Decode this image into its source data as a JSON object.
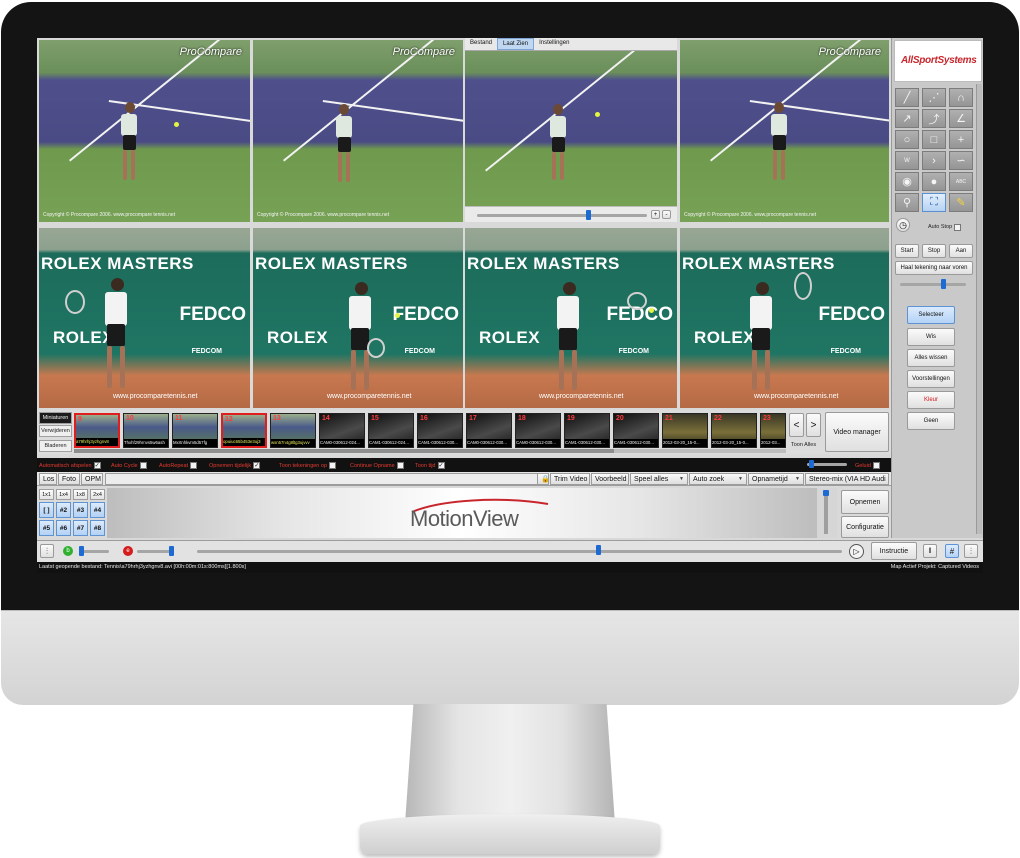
{
  "overlay": {
    "procompare_logo": "ProCompare",
    "copyright": "Copyright © Procompare 2006.  www.procompare tennis.net",
    "wall_words": [
      "ROLEX MASTERS",
      "ROLEX",
      "FEDCO",
      "FEDCOM",
      "www.procomparetennis.net"
    ]
  },
  "tile3_tabs": [
    "Bestand",
    "Laat Zien",
    "Instellingen"
  ],
  "right_panel": {
    "brand": "AllSportSystems",
    "autostop_label": "Auto Stop",
    "start": "Start",
    "stop": "Stop",
    "aan": "Aan",
    "haal_label": "Haal tekening naar voren",
    "buttons": [
      "Selecteer",
      "Wis",
      "Alles wissen",
      "Voorstellingen",
      "Kleur",
      "Geen"
    ]
  },
  "strip": {
    "tabs": [
      "Miniaturen",
      "Verwijderen",
      "Bladeren"
    ],
    "thumbs": [
      {
        "num": "9",
        "cap": "a79hrhj3yzhgnv8"
      },
      {
        "num": "10",
        "cap": "Thxhf29hrnvs5w6ash"
      },
      {
        "num": "11",
        "cap": "Mxrtnhkvm5d57fg"
      },
      {
        "num": "12",
        "cap": "opuiuc65b453e3uj3"
      },
      {
        "num": "13",
        "cap": "wsn57n4g8ltg3ujvvv"
      },
      {
        "num": "14",
        "cap": "CAM0-030612-024..."
      },
      {
        "num": "15",
        "cap": "CAM1-030612-024..."
      },
      {
        "num": "16",
        "cap": "CAM1-030612-030..."
      },
      {
        "num": "17",
        "cap": "CAM0-030612-030..."
      },
      {
        "num": "18",
        "cap": "CAM0-030612-030..."
      },
      {
        "num": "19",
        "cap": "CAM1-030612-030..."
      },
      {
        "num": "20",
        "cap": "CAM1-030612-030..."
      },
      {
        "num": "21",
        "cap": "2012-03-20_15-0..."
      },
      {
        "num": "22",
        "cap": "2012-03-20_15-0..."
      },
      {
        "num": "23",
        "cap": "2012-03..."
      }
    ],
    "prev": "<",
    "next": ">",
    "toon_alles": "Toon Alles",
    "video_manager": "Video manager"
  },
  "checkboxes": [
    "Automatisch afspelen",
    "Auto Cycle",
    "AutoRepeat",
    "Opnemen tijdelijk",
    "Toon tekeningen op",
    "Continue Opname",
    "Toon tijd",
    "Geluid"
  ],
  "menu": {
    "los": "Los",
    "foto": "Foto",
    "opm": "OPM",
    "trim_video": "Trim Video",
    "voorbeeld": "Voorbeeld",
    "speel_alles": "Speel alles",
    "auto_zoek": "Auto zoek",
    "opnametijd": "Opnametijd",
    "stereo": "Stereo-mix (VIA HD Audi"
  },
  "layout_buttons": {
    "row1": [
      "1x1",
      "1x4",
      "1x8",
      "2x4"
    ],
    "row2": [
      "[ ]",
      "#2",
      "#3",
      "#4"
    ],
    "row3": [
      "#5",
      "#6",
      "#7",
      "#8"
    ]
  },
  "logo": {
    "motion": "Motion",
    "view": "View"
  },
  "actions": {
    "opnemen": "Opnemen",
    "configuratie": "Configuratie",
    "instructie": "Instructie"
  },
  "status": {
    "left": "Laatst geopende bestand: Tennis\\a79hrhj3yzhgnv8.avi   [00h:00m:01s:800ms][1.800s]",
    "right": "Map Actief Projekt: Captured Videos"
  },
  "colors": {
    "accent": "#1d6bd2",
    "red_label": "#e53a30",
    "thumb_select": "#e01e1e"
  }
}
